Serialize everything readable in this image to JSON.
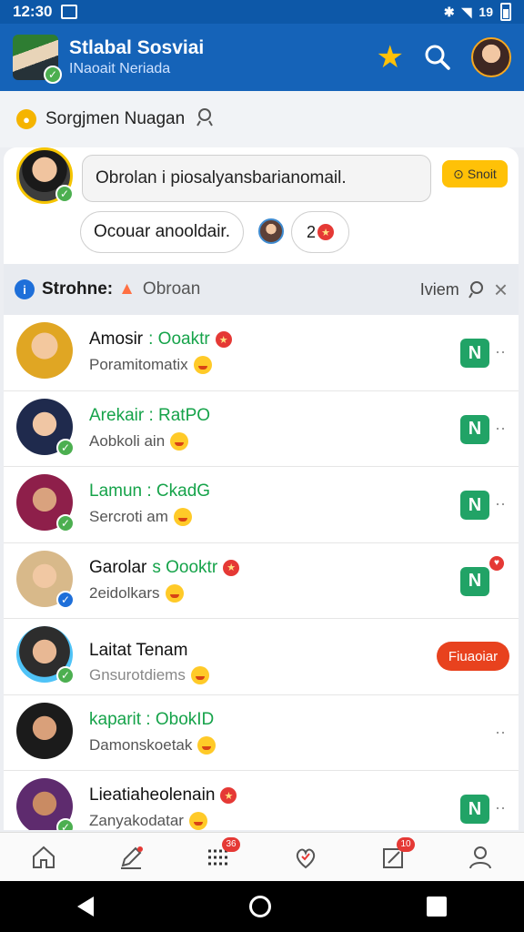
{
  "status_bar": {
    "time": "12:30",
    "signal_text": "19"
  },
  "header": {
    "title": "Stlabal Sosviai",
    "subtitle": "INaoait Neriada",
    "colors": {
      "bar": "#1563b8",
      "status": "#0d58a8",
      "accent": "#ffc107"
    }
  },
  "suggestion": {
    "title": "Sorgjmen Nuagan",
    "input_value": "Obrolan i piosalyansbarianomail.",
    "send_label": "Snoit",
    "quick_reply": "Ocouar anooldair.",
    "react_label": "2"
  },
  "list_header": {
    "title": "Strohne:",
    "tag": "Obroan",
    "right_label": "Iviem"
  },
  "chats": [
    {
      "name": "Amosir",
      "name_tail": ": Ooaktr",
      "preview": "Poramitomatix",
      "badge": "N",
      "has_fire": true,
      "name_green": false
    },
    {
      "name": "Arekair : RatPO",
      "name_tail": "",
      "preview": "Aobkoli ain",
      "badge": "N",
      "has_fire": false,
      "name_green": true
    },
    {
      "name": "Lamun : CkadG",
      "name_tail": "",
      "preview": "Sercroti am",
      "badge": "N",
      "has_fire": false,
      "name_green": true
    },
    {
      "name": "Garolar",
      "name_tail": "s Oooktr",
      "preview": "2eidolkars",
      "badge": "N",
      "has_fire": true,
      "name_green": false
    },
    {
      "name": "Laitat Tenam",
      "name_tail": "",
      "preview": "Gnsurotdiems",
      "action": "Fiuaoiar",
      "has_fire": false,
      "name_green": false
    },
    {
      "name": "kaparit : ObokID",
      "name_tail": "",
      "preview": "Damonskoetak",
      "badge": "",
      "has_fire": false,
      "name_green": true
    },
    {
      "name": "Lieatiaheolenain",
      "name_tail": "",
      "preview": "Zanyakodatar",
      "badge": "N",
      "has_fire": true,
      "name_green": false
    }
  ],
  "bottom_nav": {
    "items": [
      {
        "icon": "home-icon"
      },
      {
        "icon": "compose-icon"
      },
      {
        "icon": "list-icon",
        "badge": "36"
      },
      {
        "icon": "heart-icon"
      },
      {
        "icon": "edit-icon",
        "badge": "10"
      },
      {
        "icon": "profile-icon"
      }
    ]
  }
}
